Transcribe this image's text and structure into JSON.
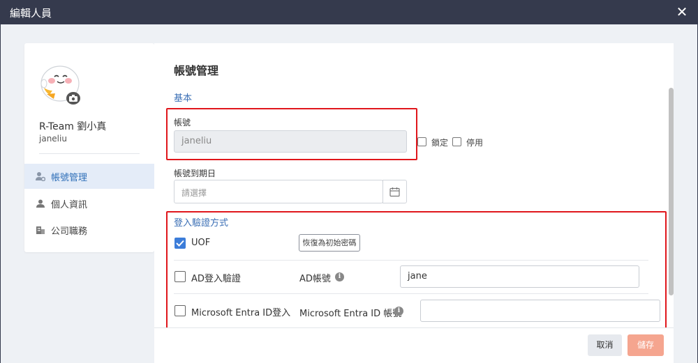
{
  "window": {
    "title": "編輯人員",
    "close_glyph": "✕"
  },
  "profile": {
    "name": "R-Team 劉小真",
    "account": "janeliu"
  },
  "sidebar": {
    "items": [
      {
        "label": "帳號管理",
        "icon": "user-gear-icon",
        "active": true
      },
      {
        "label": "個人資訊",
        "icon": "person-icon",
        "active": false
      },
      {
        "label": "公司職務",
        "icon": "building-icon",
        "active": false
      }
    ]
  },
  "main": {
    "title": "帳號管理",
    "basic_section": "基本",
    "account_label": "帳號",
    "account_value": "janeliu",
    "lock_label": "鎖定",
    "lock_checked": false,
    "disable_label": "停用",
    "disable_checked": false,
    "expiry_label": "帳號到期日",
    "expiry_placeholder": "請選擇",
    "login_section": "登入驗證方式",
    "uof": {
      "label": "UOF",
      "checked": true,
      "reset_button": "恢復為初始密碼"
    },
    "ad": {
      "label": "AD登入驗證",
      "checked": false,
      "account_label": "AD帳號",
      "account_value": "jane"
    },
    "entra": {
      "label": "Microsoft Entra ID登入",
      "checked": false,
      "account_label": "Microsoft Entra ID 帳號",
      "account_value": ""
    }
  },
  "footer": {
    "cancel_label": "取消",
    "save_label": "儲存"
  },
  "colors": {
    "titlebar": "#353a4d",
    "accent": "#3b6fb5",
    "checked": "#3c7dd9",
    "save": "#f5a58f",
    "highlight": "#e0161b"
  }
}
